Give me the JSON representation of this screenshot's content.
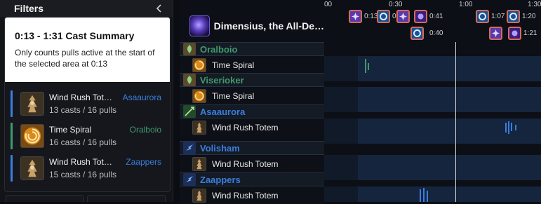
{
  "filters": {
    "title": "Filters",
    "summary": {
      "title": "0:13 - 1:31 Cast Summary",
      "description": "Only counts pulls active at the start of the selected area at 0:13"
    },
    "casts": [
      {
        "spell": "Wind Rush Tot…",
        "player": "Asaaurora",
        "player_color": "#3b7de0",
        "bar_color": "#3b7de0",
        "stats": "13 casts / 16 pulls",
        "icon": "wind-rush-totem-icon"
      },
      {
        "spell": "Time Spiral",
        "player": "Oralboio",
        "player_color": "#3f9a6e",
        "bar_color": "#3f9a6e",
        "stats": "16 casts / 16 pulls",
        "icon": "time-spiral-icon"
      },
      {
        "spell": "Wind Rush Tote…",
        "player": "Zaappers",
        "player_color": "#3b7de0",
        "bar_color": "#3b7de0",
        "stats": "15 casts / 16 pulls",
        "icon": "wind-rush-totem-icon"
      }
    ]
  },
  "timeline": {
    "ticks": [
      "00",
      "0:30",
      "1:00",
      "1:30"
    ],
    "boss": {
      "name": "Dimensius, the All-De…",
      "abilities": [
        {
          "time": "0:13",
          "icon": "void-burst-icon"
        },
        {
          "time": "0",
          "icon": "portal-icon"
        },
        {
          "time": "0:41",
          "icon": "void-orb-icon"
        },
        {
          "time": "0:40",
          "icon": "portal-icon"
        },
        {
          "time": "1:07",
          "icon": "portal-icon"
        },
        {
          "time": "1:20",
          "icon": "portal-icon"
        },
        {
          "time": "1:21",
          "icon": "void-orb-icon"
        }
      ]
    },
    "players": [
      {
        "name": "Oralboio",
        "color": "#3f9a6e",
        "class_icon": "druid-icon",
        "spell": "Time Spiral",
        "spell_icon": "time-spiral-icon"
      },
      {
        "name": "Viserioker",
        "color": "#3f9a6e",
        "class_icon": "druid-icon",
        "spell": "Time Spiral",
        "spell_icon": "time-spiral-icon"
      },
      {
        "name": "Asaaurora",
        "color": "#3b7de0",
        "class_icon": "hunter-icon",
        "spell": "Wind Rush Totem",
        "spell_icon": "wind-rush-totem-icon"
      },
      {
        "name": "Volisham",
        "color": "#3b7de0",
        "class_icon": "shaman-icon",
        "spell": "Wind Rush Totem",
        "spell_icon": "wind-rush-totem-icon"
      },
      {
        "name": "Zaappers",
        "color": "#3b7de0",
        "class_icon": "shaman-icon",
        "spell": "Wind Rush Totem",
        "spell_icon": "wind-rush-totem-icon"
      }
    ]
  }
}
